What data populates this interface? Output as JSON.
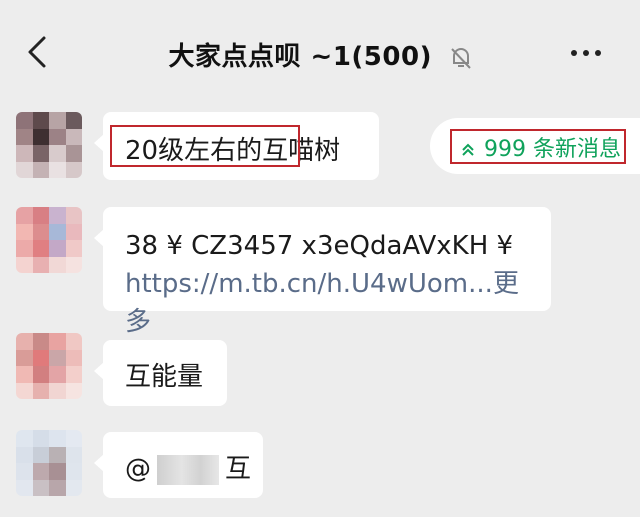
{
  "header": {
    "title": "大家点点呗 ~1(500)",
    "back_icon": "back-arrow-icon",
    "mute_icon": "bell-muted-icon",
    "more_icon": "more-dots-icon"
  },
  "messages": [
    {
      "text_highlight": "20级左右的互",
      "text_rest": "喵树"
    },
    {
      "line1": "38 ¥  CZ3457 x3eQdaAVxKH ¥",
      "link": "https://m.tb.cn/h.U4wUom...",
      "more": "更多"
    },
    {
      "text": "互能量"
    },
    {
      "prefix": "@",
      "suffix": "互"
    }
  ],
  "new_messages": {
    "label": "999 条新消息",
    "icon": "double-chevron-up-icon"
  },
  "colors": {
    "background": "#ededed",
    "bubble": "#ffffff",
    "accent_green": "#0fa25b",
    "highlight_red": "#c0272d",
    "link": "#5a6c89"
  }
}
